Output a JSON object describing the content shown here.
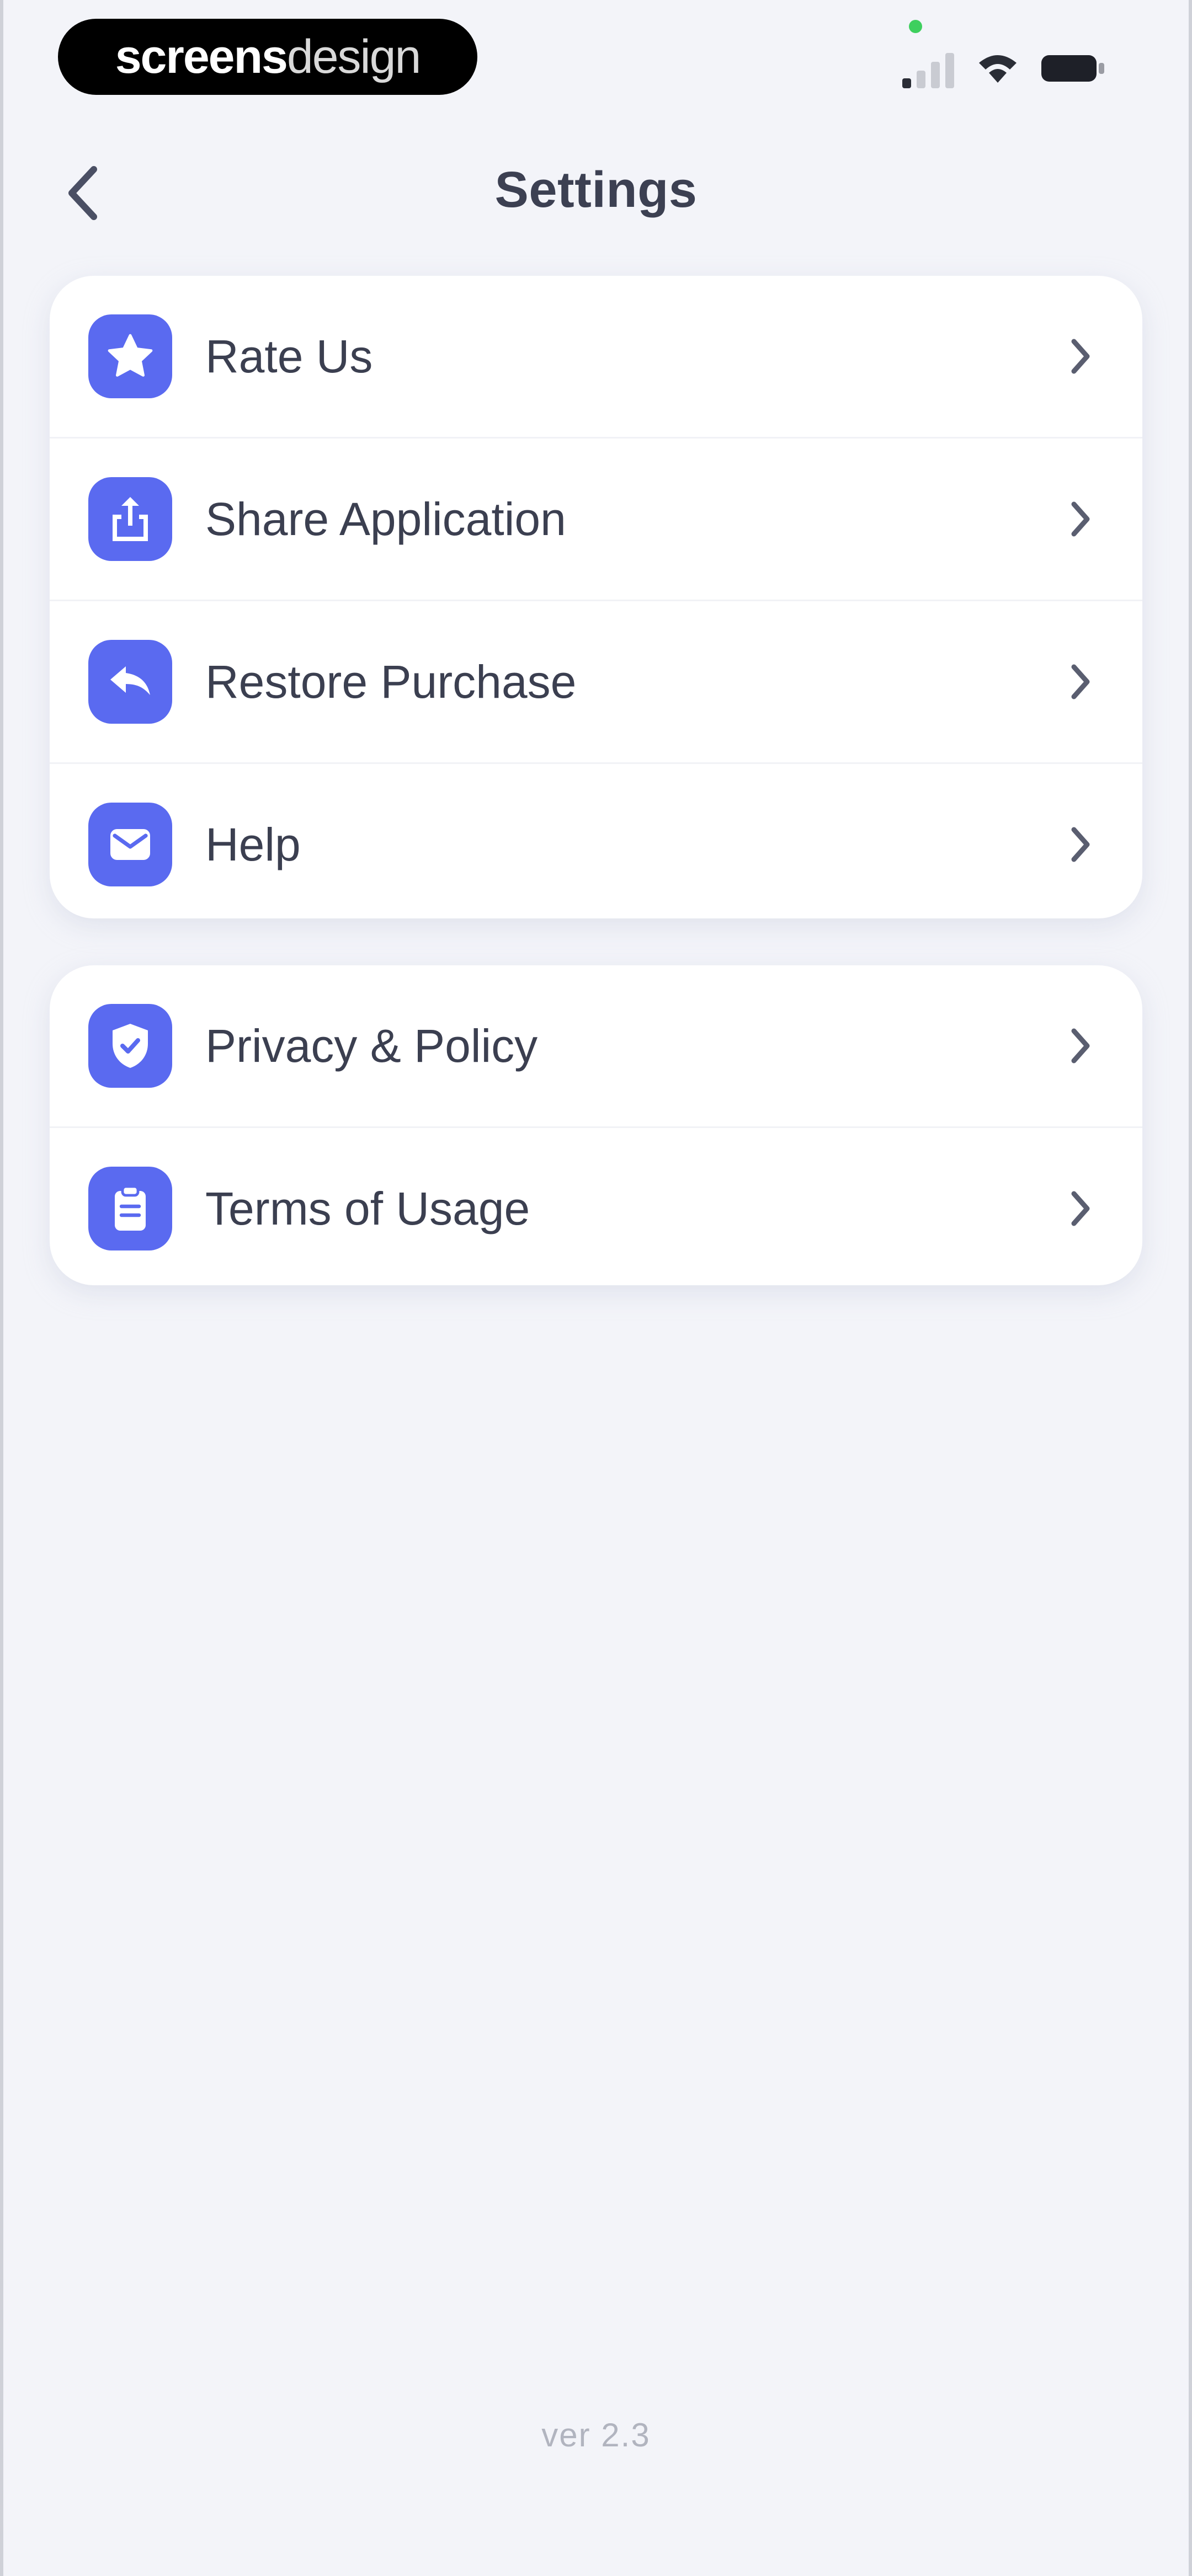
{
  "status_bar": {
    "brand_bold": "screens",
    "brand_light": "design"
  },
  "header": {
    "title": "Settings"
  },
  "sections": [
    {
      "items": [
        {
          "label": "Rate Us",
          "icon": "star-icon"
        },
        {
          "label": "Share Application",
          "icon": "share-icon"
        },
        {
          "label": "Restore Purchase",
          "icon": "restore-icon"
        },
        {
          "label": "Help",
          "icon": "mail-icon"
        }
      ]
    },
    {
      "items": [
        {
          "label": "Privacy & Policy",
          "icon": "shield-check-icon"
        },
        {
          "label": "Terms of Usage",
          "icon": "clipboard-icon"
        }
      ]
    }
  ],
  "footer": {
    "version": "ver 2.3"
  },
  "colors": {
    "accent": "#5a6af0",
    "background": "#f3f4f9",
    "card": "#ffffff",
    "text": "#3b3f50",
    "muted": "#b1b4bf"
  }
}
